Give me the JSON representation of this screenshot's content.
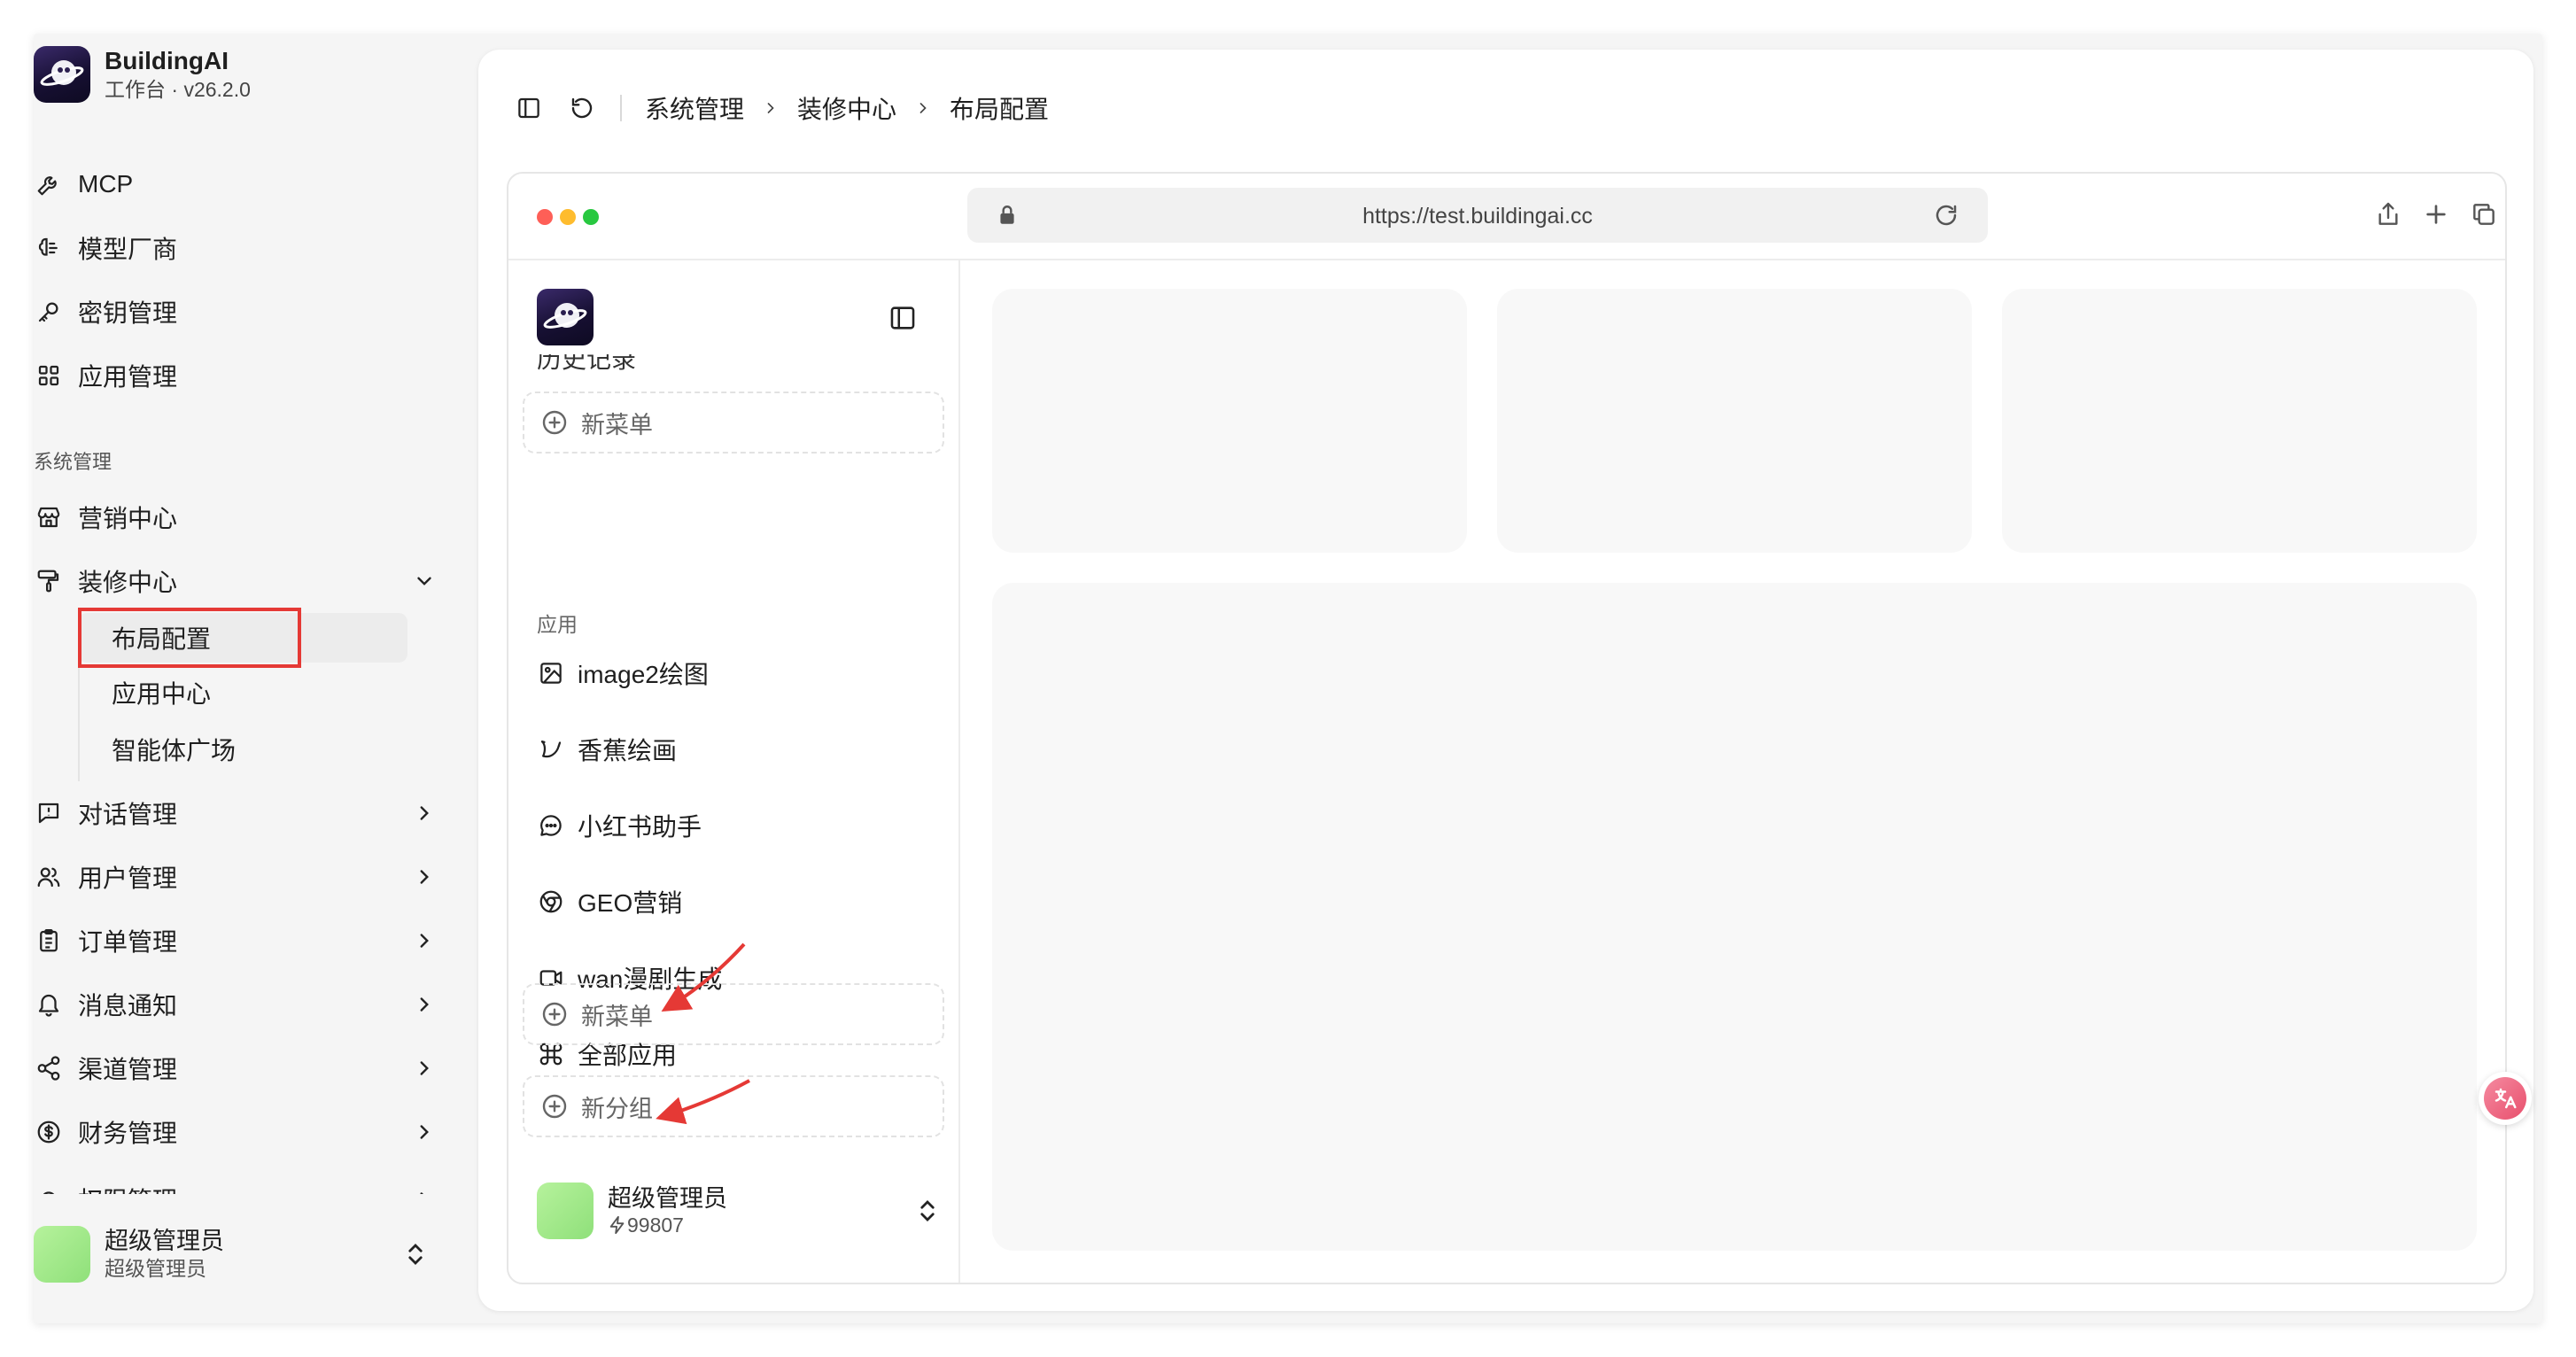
{
  "app": {
    "name": "BuildingAI",
    "version_line": "工作台 · v26.2.0"
  },
  "sidebar": {
    "top_items": [
      {
        "label": "MCP",
        "icon": "wrench-icon"
      },
      {
        "label": "模型厂商",
        "icon": "brain-icon"
      },
      {
        "label": "密钥管理",
        "icon": "key-icon"
      },
      {
        "label": "应用管理",
        "icon": "grid-icon"
      }
    ],
    "section_label": "系统管理",
    "system_items": [
      {
        "label": "营销中心",
        "icon": "store-icon"
      },
      {
        "label": "装修中心",
        "icon": "paint-roller-icon",
        "expanded": true
      }
    ],
    "decor_sub_items": [
      {
        "label": "布局配置",
        "active": true
      },
      {
        "label": "应用中心"
      },
      {
        "label": "智能体广场"
      }
    ],
    "more_items": [
      {
        "label": "对话管理",
        "icon": "chat-icon"
      },
      {
        "label": "用户管理",
        "icon": "users-icon"
      },
      {
        "label": "订单管理",
        "icon": "clipboard-icon"
      },
      {
        "label": "消息通知",
        "icon": "bell-icon"
      },
      {
        "label": "渠道管理",
        "icon": "share-icon"
      },
      {
        "label": "财务管理",
        "icon": "dollar-icon"
      },
      {
        "label": "权限管理",
        "icon": "lock-icon"
      }
    ],
    "user": {
      "name": "超级管理员",
      "role": "超级管理员"
    }
  },
  "topbar": {
    "breadcrumb": [
      "系统管理",
      "装修中心",
      "布局配置"
    ]
  },
  "browser": {
    "url": "https://test.buildingai.cc",
    "dots": [
      "#fe5f57",
      "#febc2e",
      "#28c840"
    ]
  },
  "preview": {
    "cut_text": "历史记录",
    "new_menu_label": "新菜单",
    "section_label": "应用",
    "apps": [
      {
        "label": "image2绘图",
        "icon": "image-icon"
      },
      {
        "label": "香蕉绘画",
        "icon": "banana-icon"
      },
      {
        "label": "小红书助手",
        "icon": "message-circle-icon"
      },
      {
        "label": "GEO营销",
        "icon": "chrome-icon"
      },
      {
        "label": "wan漫剧生成",
        "icon": "video-icon"
      },
      {
        "label": "全部应用",
        "icon": "command-icon"
      }
    ],
    "new_menu_label_2": "新菜单",
    "new_group_label": "新分组",
    "user": {
      "name": "超级管理员",
      "points": "99807"
    }
  },
  "colors": {
    "highlight": "#e53935",
    "arrow": "#e53935",
    "card": "#f8f8f8"
  }
}
